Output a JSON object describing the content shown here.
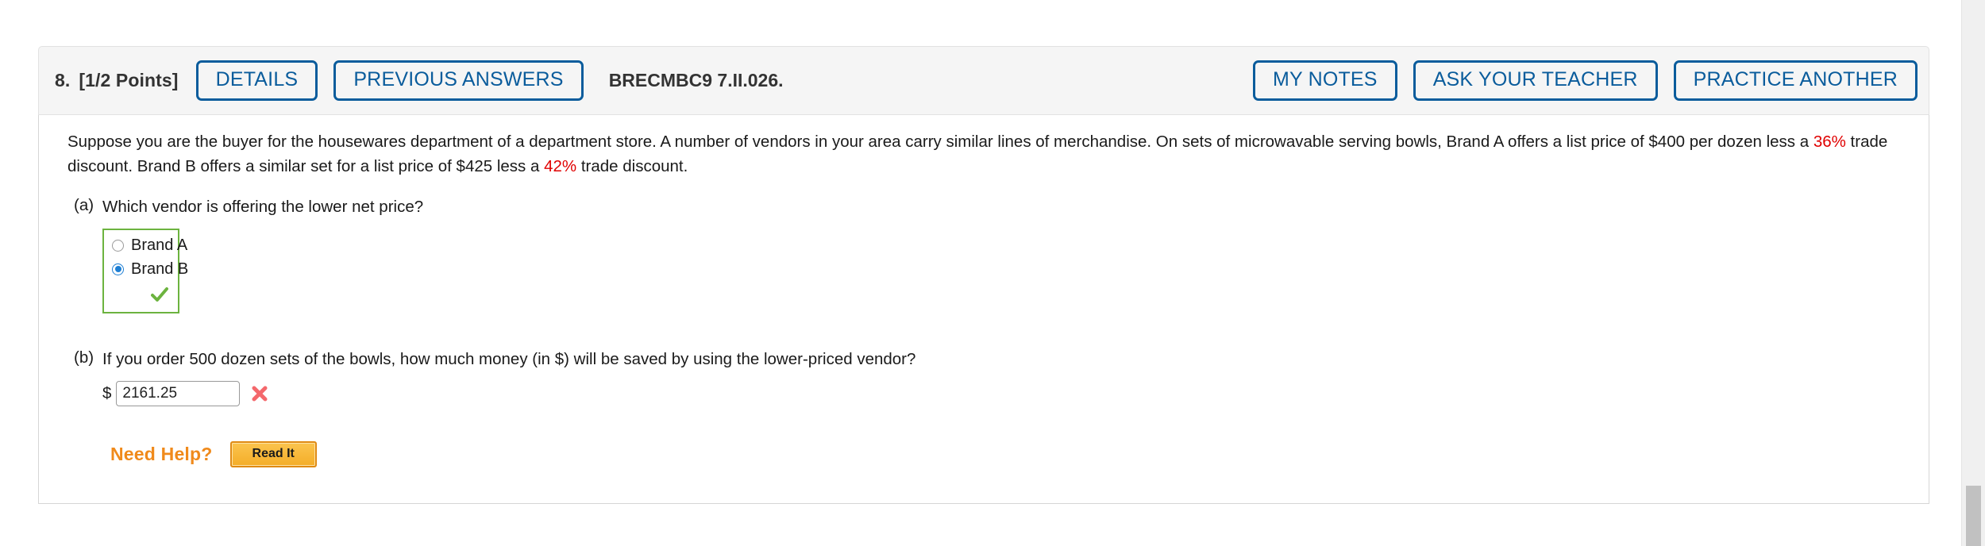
{
  "question": {
    "number": "8.",
    "points": "[1/2 Points]",
    "details_button": "DETAILS",
    "previous_answers_button": "PREVIOUS ANSWERS",
    "problem_code": "BRECMBC9 7.II.026.",
    "my_notes_button": "MY NOTES",
    "ask_teacher_button": "ASK YOUR TEACHER",
    "practice_another_button": "PRACTICE ANOTHER",
    "stem": {
      "text_1": "Suppose you are the buyer for the housewares department of a department store. A number of vendors in your area carry similar lines of merchandise. On sets of microwavable serving bowls, Brand A offers a list price of $400 per dozen less a ",
      "highlight_1": "36%",
      "text_2": " trade discount. Brand B offers a similar set for a list price of $425 less a ",
      "highlight_2": "42%",
      "text_3": " trade discount."
    },
    "parts": [
      {
        "label": "(a)",
        "prompt": "Which vendor is offering the lower net price?",
        "choices": [
          {
            "label": "Brand A",
            "selected": false
          },
          {
            "label": "Brand B",
            "selected": true
          }
        ],
        "result_mark": "✔",
        "result_state": "correct"
      },
      {
        "label": "(b)",
        "prompt": "If you order 500 dozen sets of the bowls, how much money (in $) will be saved by using the lower-priced vendor?",
        "currency_symbol": "$",
        "answer_value": "2161.25",
        "answer_placeholder": "",
        "result_mark": "✖",
        "result_state": "incorrect"
      }
    ],
    "need_help_label": "Need Help?",
    "read_it_button": "Read It"
  },
  "colors": {
    "button_blue": "#0a5c9c",
    "correct_green": "#6cb33f",
    "incorrect_red": "#f4686c",
    "highlight_red": "#e00000",
    "need_help_orange": "#f08a1b"
  }
}
